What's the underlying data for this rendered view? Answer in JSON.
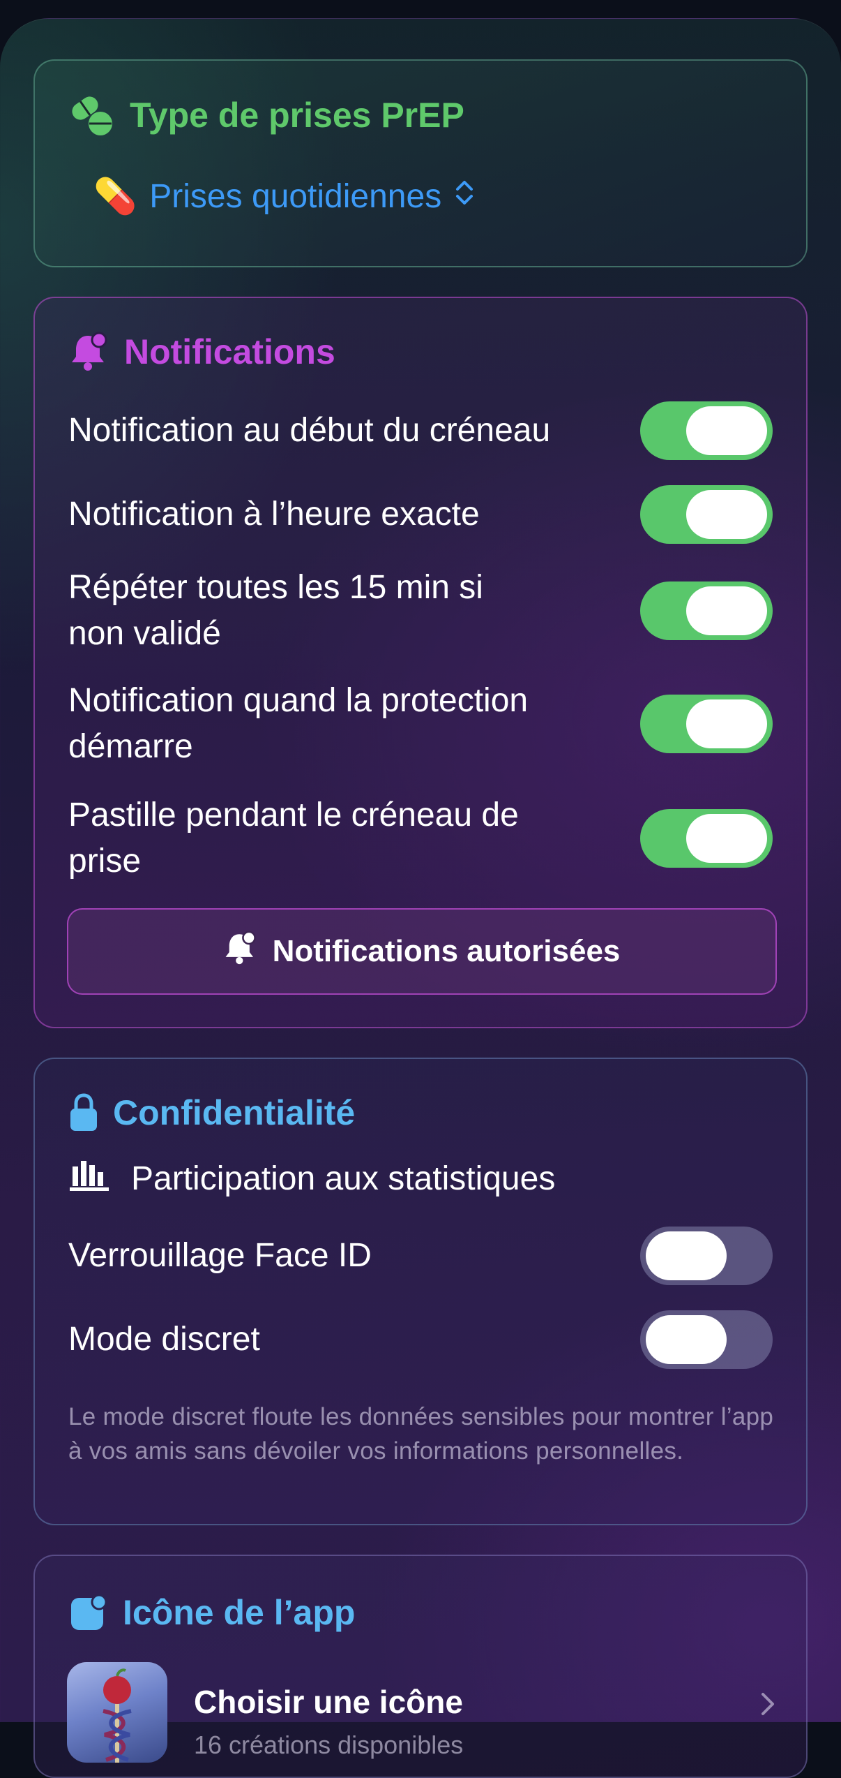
{
  "colors": {
    "green": "#5fc96b",
    "magenta": "#c44be0",
    "blue": "#5ab8f2",
    "link_blue": "#3d9af7",
    "toggle_on": "#59c76b"
  },
  "prep_card": {
    "icon": "pills-icon",
    "title": "Type de prises PrEP",
    "selection_emoji": "💊",
    "selection_label": "Prises quotidiennes",
    "selection_icon": "chevron-up-down-icon"
  },
  "notifications_card": {
    "icon": "bell-badge-icon",
    "title": "Notifications",
    "rows": [
      {
        "label": "Notification au début du créneau",
        "on": true
      },
      {
        "label": "Notification à l’heure exacte",
        "on": true
      },
      {
        "label": "Répéter toutes les 15 min si non validé",
        "on": true
      },
      {
        "label": "Notification quand la protection démarre",
        "on": true
      },
      {
        "label": "Pastille pendant le créneau de prise",
        "on": true
      }
    ],
    "button_label": "Notifications autorisées",
    "button_icon": "bell-badge-icon"
  },
  "privacy_card": {
    "icon": "lock-icon",
    "title": "Confidentialité",
    "stats_icon": "chart-bar-icon",
    "stats_label": "Participation aux statistiques",
    "rows": [
      {
        "label": "Verrouillage Face ID",
        "on": false
      },
      {
        "label": "Mode discret",
        "on": false
      }
    ],
    "footnote": "Le mode discret floute les données sensibles pour montrer l’app à vos amis sans dévoiler vos informations personnelles."
  },
  "app_icon_card": {
    "icon": "app-badge-icon",
    "title": "Icône de l’app",
    "row_title": "Choisir une icône",
    "row_subtitle": "16 créations disponibles",
    "row_icon": "chevron-right-icon"
  }
}
